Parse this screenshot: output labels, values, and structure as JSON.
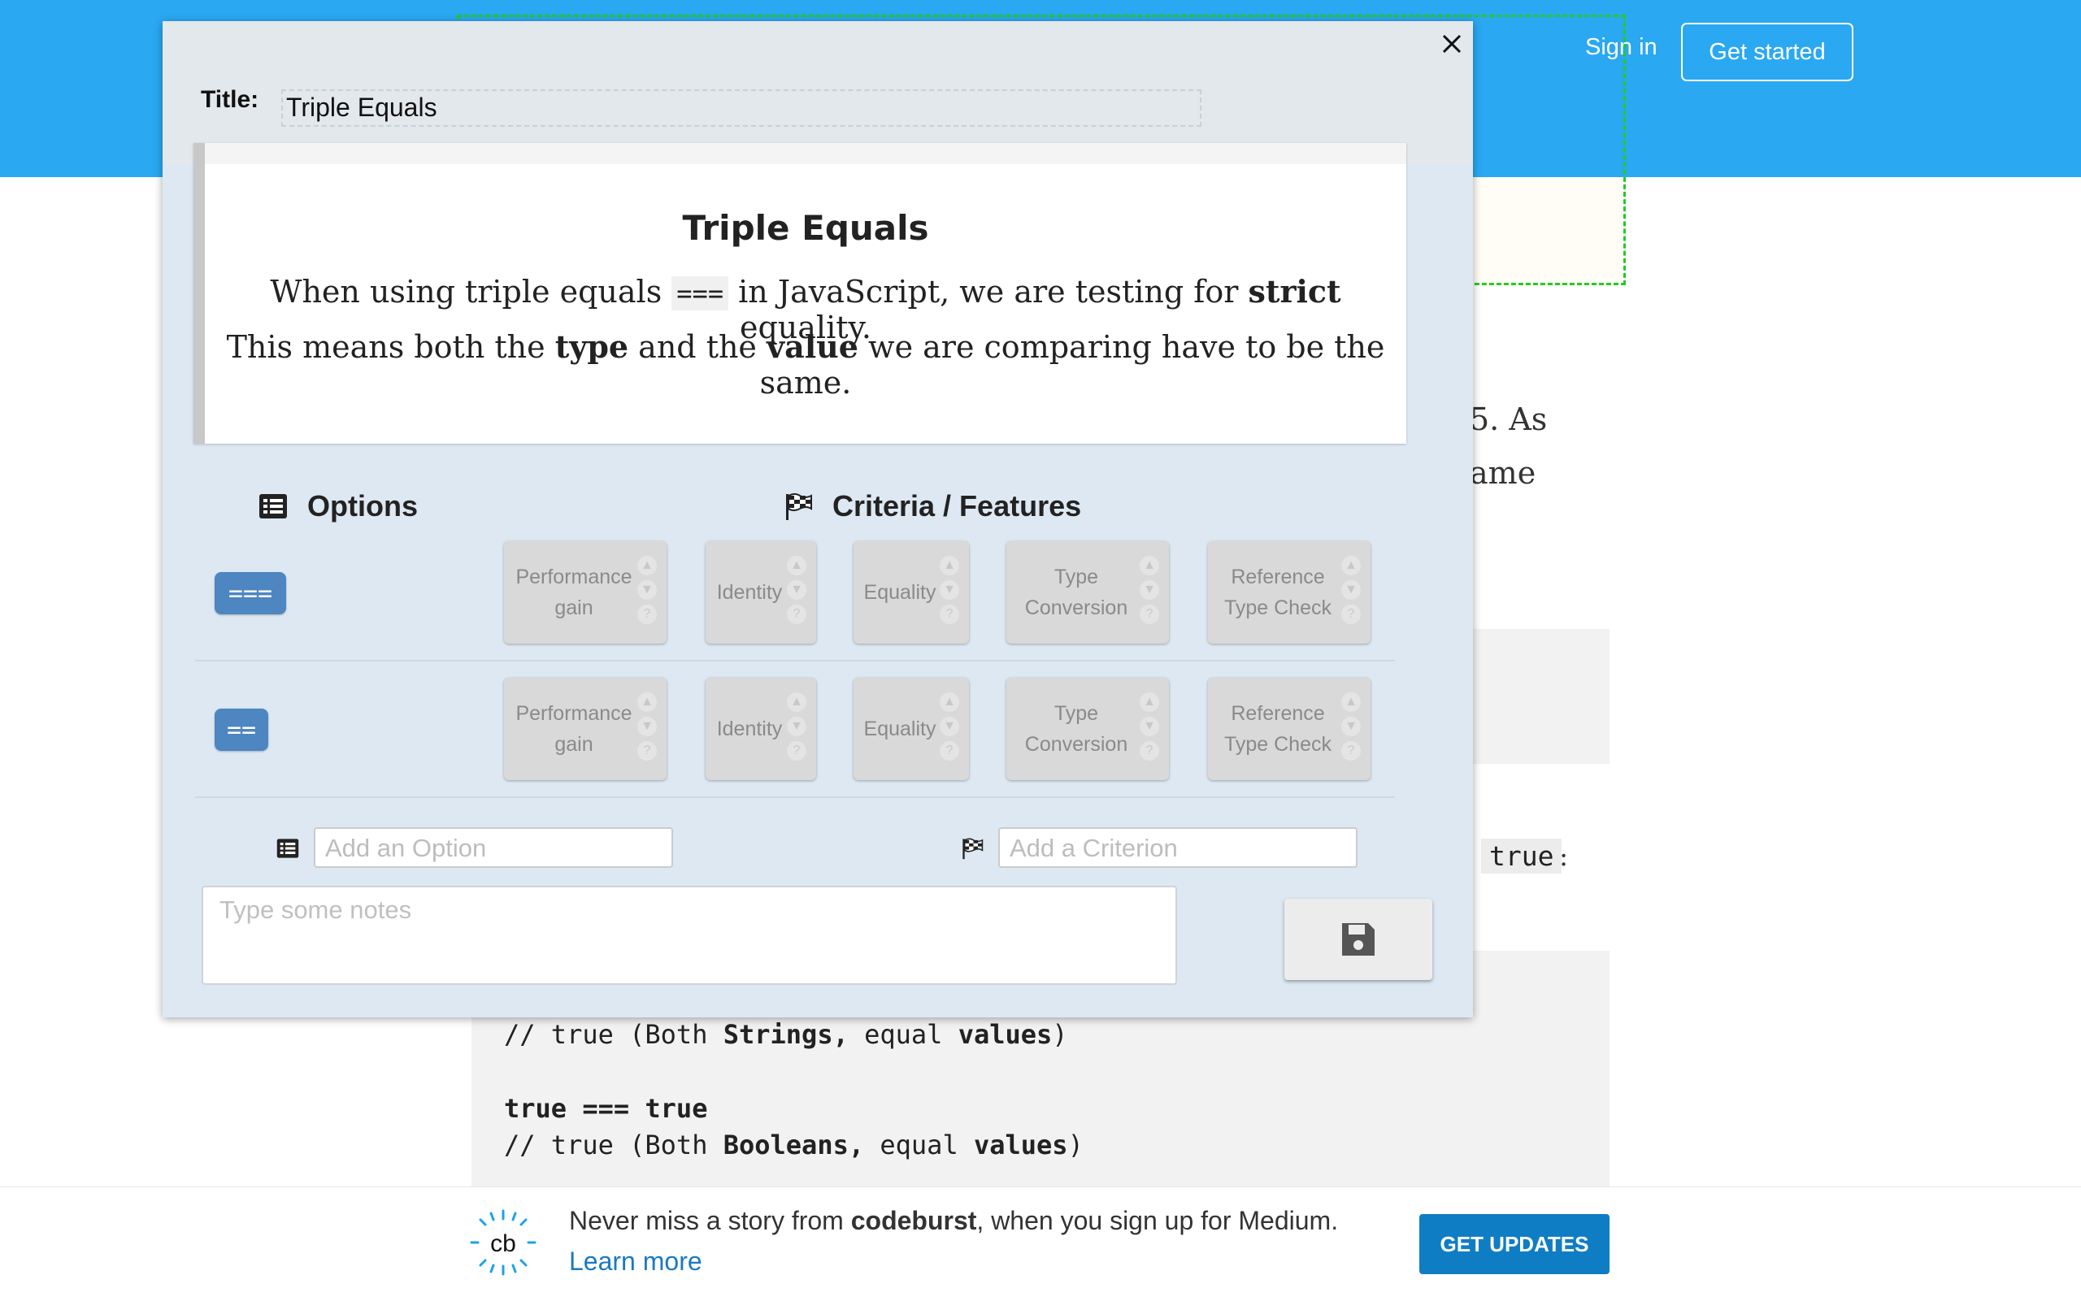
{
  "header": {
    "signin_label": "Sign in",
    "getstarted_label": "Get started"
  },
  "article": {
    "fragment_1": "5. As",
    "fragment_2": "ame",
    "inline_code": "true",
    "inline_colon": ":",
    "code_lines": [
      {
        "plain_1": "// true (Both ",
        "bold_1": "Strings,",
        "plain_2": " equal ",
        "bold_2": "values",
        "plain_3": ")"
      },
      {
        "bold_1": "true === true"
      },
      {
        "plain_1": "// true (Both ",
        "bold_1": "Booleans,",
        "plain_2": " equal ",
        "bold_2": "values",
        "plain_3": ")"
      }
    ]
  },
  "footer": {
    "logo_text": "cb",
    "message_prefix": "Never miss a story from ",
    "message_brand": "codeburst",
    "message_suffix": ", when you sign up for Medium.",
    "learn_more": "Learn more",
    "get_updates": "GET UPDATES"
  },
  "modal": {
    "close_icon": "close-icon",
    "title_label": "Title:",
    "title_value": "Triple Equals",
    "preview": {
      "heading": "Triple Equals",
      "line1_a": "When using triple equals ",
      "line1_code": "===",
      "line1_b": " in JavaScript, we are testing for ",
      "line1_strong": "strict",
      "line1_c": " equality.",
      "line2_a": "This means both the ",
      "line2_strong1": "type",
      "line2_b": " and the ",
      "line2_strong2": "value",
      "line2_c": " we are comparing have to be the same."
    },
    "options_heading": "Options",
    "criteria_heading": "Criteria / Features",
    "options": [
      {
        "label": "===",
        "criteria": [
          {
            "line1": "Performance",
            "line2": "gain"
          },
          {
            "line1": "Identity",
            "line2": ""
          },
          {
            "line1": "Equality",
            "line2": ""
          },
          {
            "line1": "Type",
            "line2": "Conversion"
          },
          {
            "line1": "Reference",
            "line2": "Type Check"
          }
        ]
      },
      {
        "label": "==",
        "criteria": [
          {
            "line1": "Performance",
            "line2": "gain"
          },
          {
            "line1": "Identity",
            "line2": ""
          },
          {
            "line1": "Equality",
            "line2": ""
          },
          {
            "line1": "Type",
            "line2": "Conversion"
          },
          {
            "line1": "Reference",
            "line2": "Type Check"
          }
        ]
      }
    ],
    "add_option_placeholder": "Add an Option",
    "add_criterion_placeholder": "Add a Criterion",
    "notes_placeholder": "Type some notes",
    "save_icon": "floppy-disk-icon",
    "colors": {
      "header_blue": "#2aa8f2",
      "option_blue": "#4d86c0",
      "modal_bg": "#dde8f3",
      "footer_button": "#0f7dc4"
    }
  }
}
